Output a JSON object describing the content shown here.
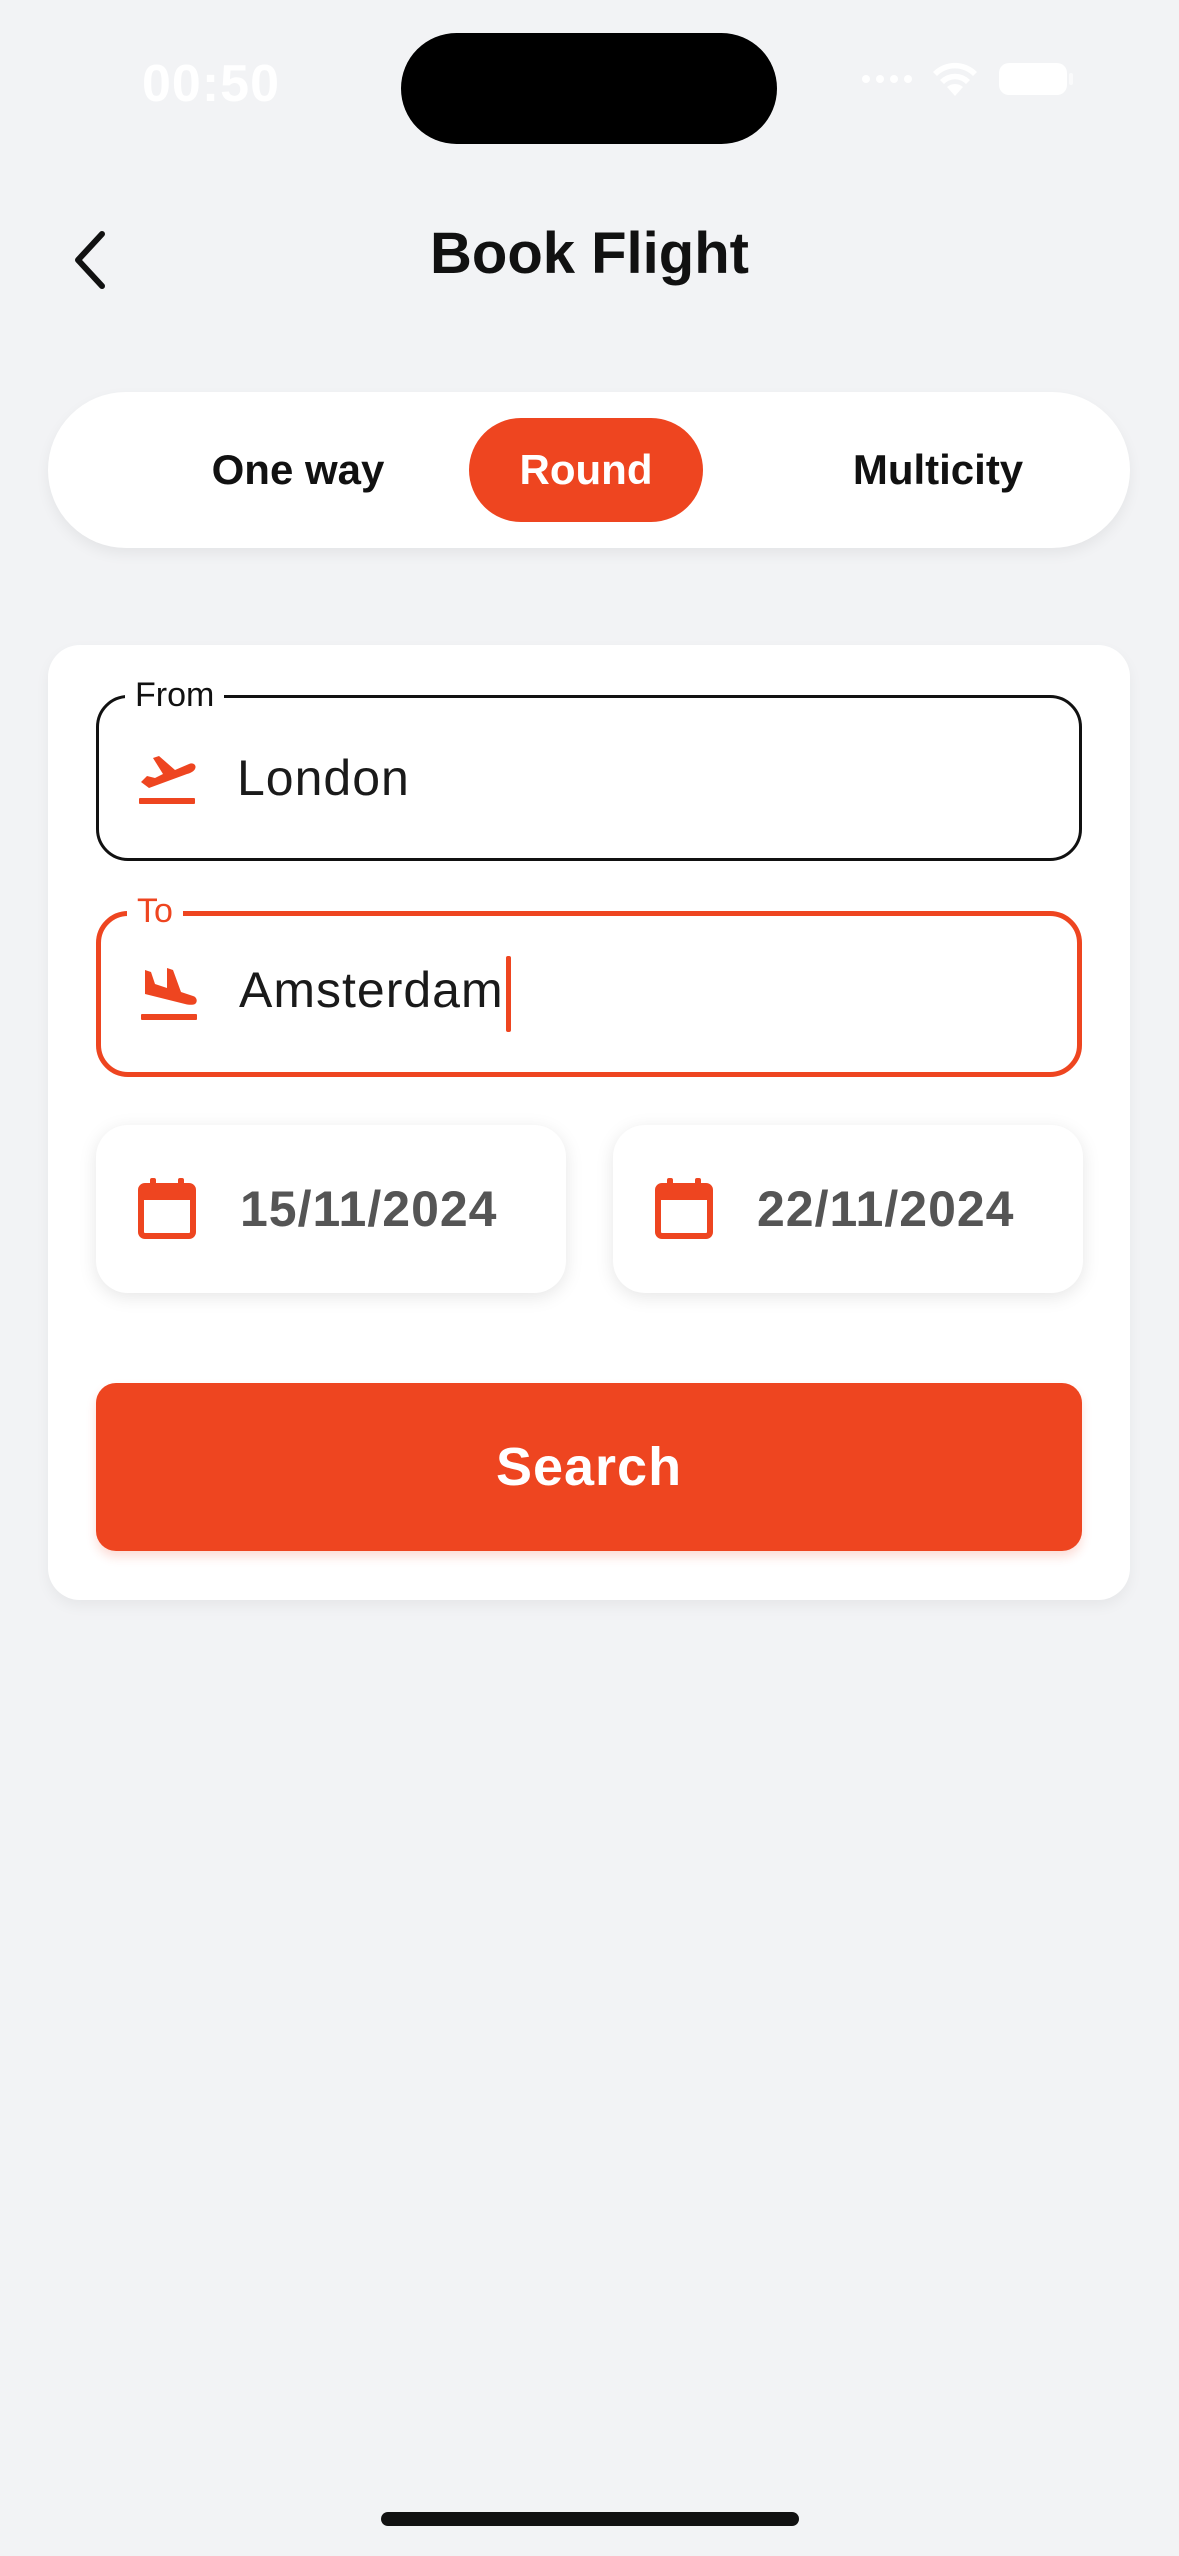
{
  "status_bar": {
    "time": "00:50"
  },
  "header": {
    "title": "Book Flight",
    "back_icon": "chevron-left-icon"
  },
  "trip_types": {
    "items": [
      {
        "label": "One way"
      },
      {
        "label": "Round"
      },
      {
        "label": "Multicity"
      }
    ],
    "selected": "Round"
  },
  "form": {
    "from": {
      "label": "From",
      "value": "London",
      "icon": "flight-takeoff-icon"
    },
    "to": {
      "label": "To",
      "value": "Amsterdam",
      "icon": "flight-land-icon",
      "focused": true
    },
    "departure_date": {
      "value": "15/11/2024",
      "icon": "calendar-icon"
    },
    "return_date": {
      "value": "22/11/2024",
      "icon": "calendar-icon"
    },
    "search_label": "Search"
  },
  "colors": {
    "accent": "#ee4520",
    "background": "#f2f3f5",
    "card": "#ffffff",
    "text": "#111111",
    "date_text": "#555555"
  }
}
